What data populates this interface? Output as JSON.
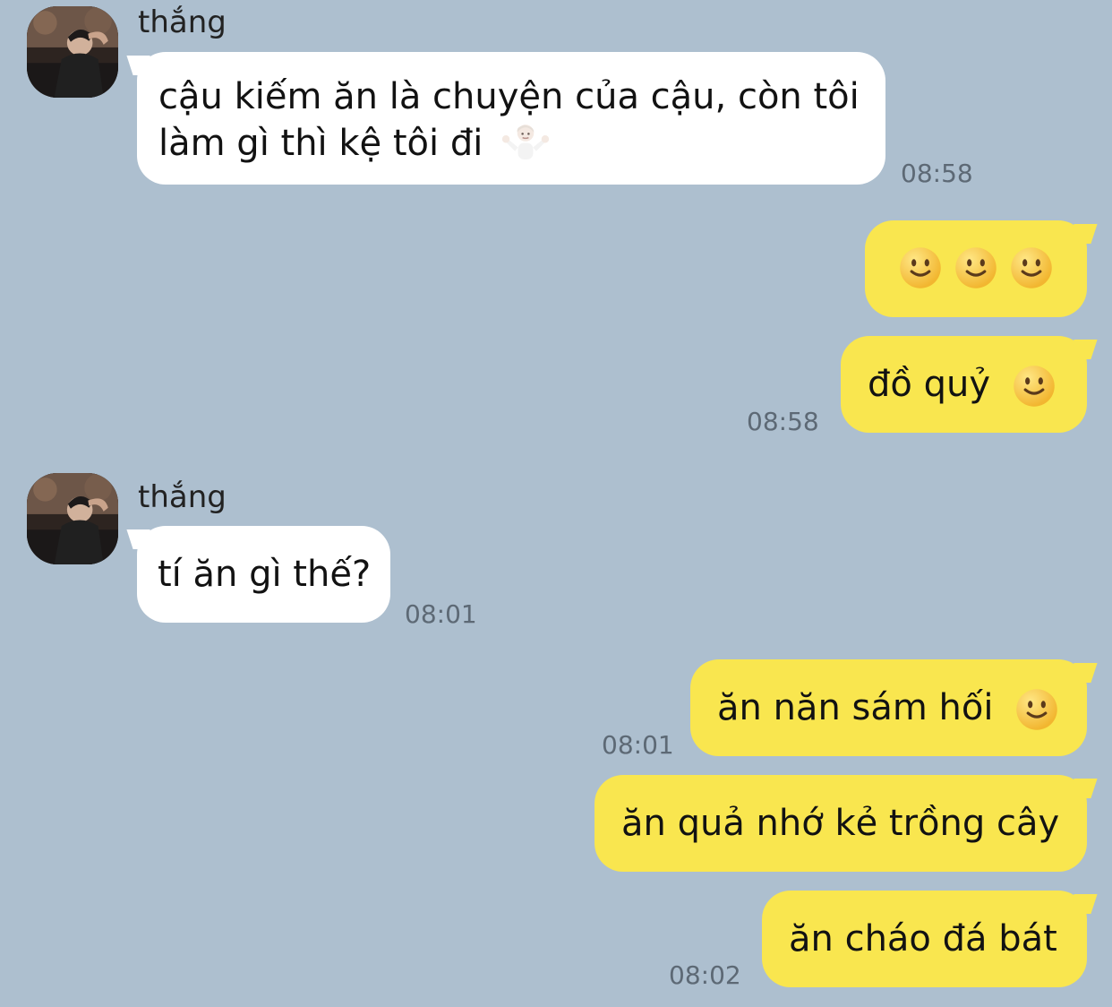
{
  "chat": {
    "messages": [
      {
        "sender": "thắng",
        "text_line_1": "cậu kiếm ăn là chuyện của cậu, còn tôi",
        "text_line_2": "làm gì thì kệ tôi đi",
        "time": "08:58",
        "emoji": "shrug-emoji"
      },
      {
        "emoji": [
          "slightly-smiling-face-emoji",
          "slightly-smiling-face-emoji",
          "slightly-smiling-face-emoji"
        ]
      },
      {
        "text": "đồ quỷ",
        "time": "08:58",
        "emoji": "slightly-smiling-face-emoji"
      },
      {
        "sender": "thắng",
        "text": "tí ăn gì thế?",
        "time": "08:01"
      },
      {
        "text": "ăn năn sám hối",
        "time": "08:01",
        "emoji": "slightly-smiling-face-emoji"
      },
      {
        "text": "ăn quả nhớ kẻ trồng cây"
      },
      {
        "text": "ăn cháo đá bát",
        "time": "08:02"
      }
    ]
  },
  "colors": {
    "background": "#adbfcf",
    "incoming_bubble": "#ffffff",
    "outgoing_bubble": "#f9e64f",
    "timestamp": "#5d6975",
    "emoji_face": "#f7c948"
  }
}
